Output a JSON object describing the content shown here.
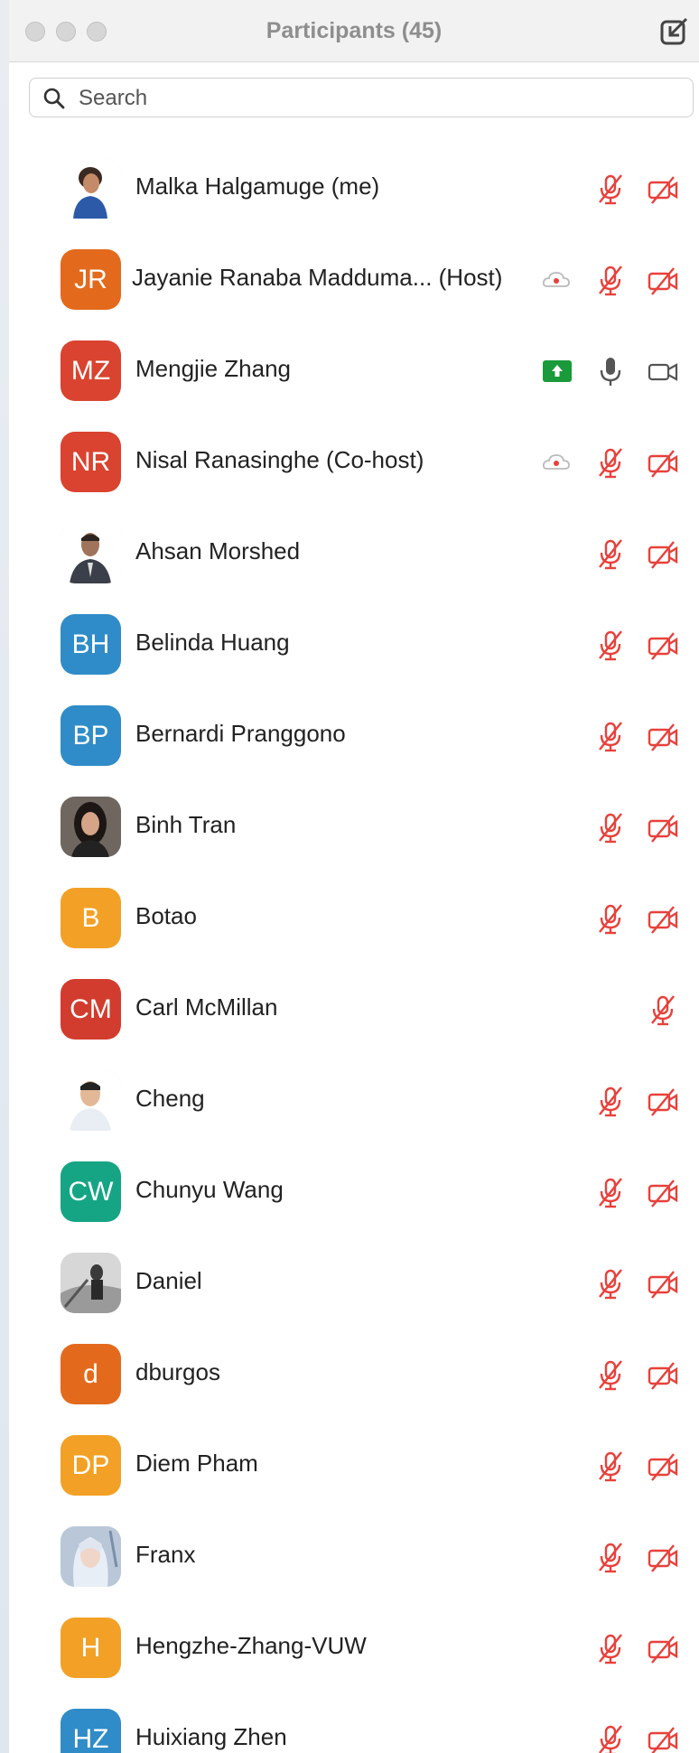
{
  "window": {
    "title": "Participants (45)"
  },
  "search": {
    "placeholder": "Search"
  },
  "colors": {
    "red_icon": "#e8413b",
    "gray_icon": "#666666",
    "share_green": "#1a9a3a"
  },
  "participants": [
    {
      "name": "Malka Halgamuge (me)",
      "avatar": "photo-woman",
      "mic": "muted",
      "cam": "off"
    },
    {
      "name": "Jayanie Ranaba Madduma...  (Host)",
      "initials": "JR",
      "color": "#e36a1c",
      "rec": true,
      "mic": "muted",
      "cam": "off"
    },
    {
      "name": "Mengjie Zhang",
      "initials": "MZ",
      "color": "#d9432f",
      "share": true,
      "mic": "on",
      "cam": "on"
    },
    {
      "name": "Nisal Ranasinghe (Co-host)",
      "initials": "NR",
      "color": "#d9432f",
      "rec": true,
      "mic": "muted",
      "cam": "off"
    },
    {
      "name": "Ahsan Morshed",
      "avatar": "photo-man",
      "mic": "muted",
      "cam": "off"
    },
    {
      "name": "Belinda Huang",
      "initials": "BH",
      "color": "#2f8cc8",
      "mic": "muted",
      "cam": "off"
    },
    {
      "name": "Bernardi Pranggono",
      "initials": "BP",
      "color": "#2f8cc8",
      "mic": "muted",
      "cam": "off"
    },
    {
      "name": "Binh Tran",
      "avatar": "photo-woman2",
      "mic": "muted",
      "cam": "off"
    },
    {
      "name": "Botao",
      "initials": "B",
      "color": "#f2a126",
      "mic": "muted",
      "cam": "off"
    },
    {
      "name": "Carl McMillan",
      "initials": "CM",
      "color": "#d23c2e",
      "mic": "muted",
      "cam": "none"
    },
    {
      "name": "Cheng",
      "avatar": "photo-man2",
      "mic": "muted",
      "cam": "off"
    },
    {
      "name": "Chunyu Wang",
      "initials": "CW",
      "color": "#15a584",
      "mic": "muted",
      "cam": "off"
    },
    {
      "name": "Daniel",
      "avatar": "photo-daniel",
      "mic": "muted",
      "cam": "off"
    },
    {
      "name": "dburgos",
      "initials": "d",
      "color": "#e36a1c",
      "mic": "muted",
      "cam": "off"
    },
    {
      "name": "Diem Pham",
      "initials": "DP",
      "color": "#f2a126",
      "mic": "muted",
      "cam": "off"
    },
    {
      "name": "Franx",
      "avatar": "photo-franx",
      "mic": "muted",
      "cam": "off"
    },
    {
      "name": "Hengzhe-Zhang-VUW",
      "initials": "H",
      "color": "#f2a126",
      "mic": "muted",
      "cam": "off"
    },
    {
      "name": "Huixiang Zhen",
      "initials": "HZ",
      "color": "#2f8cc8",
      "mic": "muted",
      "cam": "off"
    }
  ]
}
